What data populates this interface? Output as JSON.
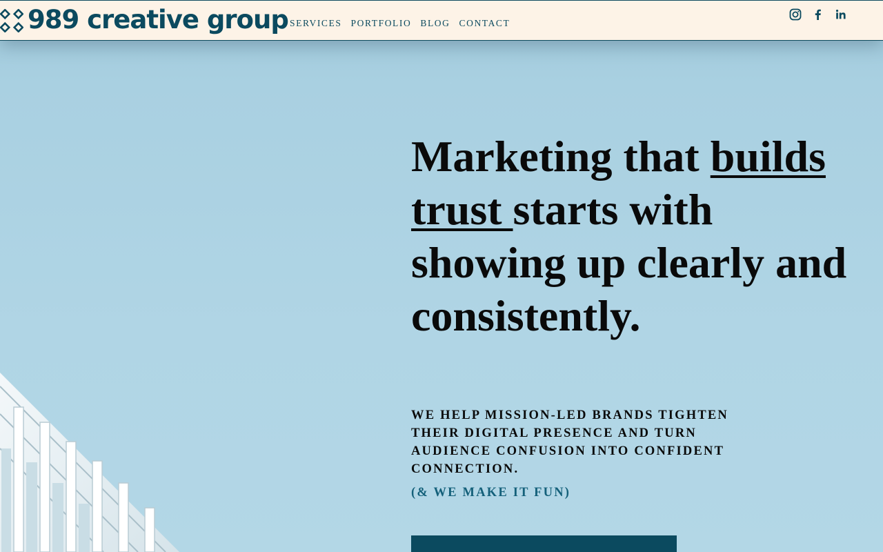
{
  "header": {
    "logo_text": "989 creative group",
    "nav": [
      {
        "label": "SERVICES"
      },
      {
        "label": "PORTFOLIO"
      },
      {
        "label": "BLOG"
      },
      {
        "label": "CONTACT"
      }
    ],
    "social": [
      {
        "icon": "instagram-icon"
      },
      {
        "icon": "facebook-icon"
      },
      {
        "icon": "linkedin-icon"
      }
    ]
  },
  "hero": {
    "title_part1": "Marketing that ",
    "title_highlight": "builds trust ",
    "title_part2": "starts with showing up clearly and consistently.",
    "subhead": "WE HELP MISSION-LED BRANDS TIGHTEN THEIR DIGITAL PRESENCE AND TURN AUDIENCE CONFUSION INTO CONFIDENT CONNECTION.",
    "tagline": "(& WE MAKE IT FUN)",
    "cta_label": ""
  },
  "colors": {
    "brand": "#0b4a5f",
    "header_bg": "#fdf3e7",
    "hero_bg": "#b0d5e5",
    "tagline": "#14607a"
  }
}
